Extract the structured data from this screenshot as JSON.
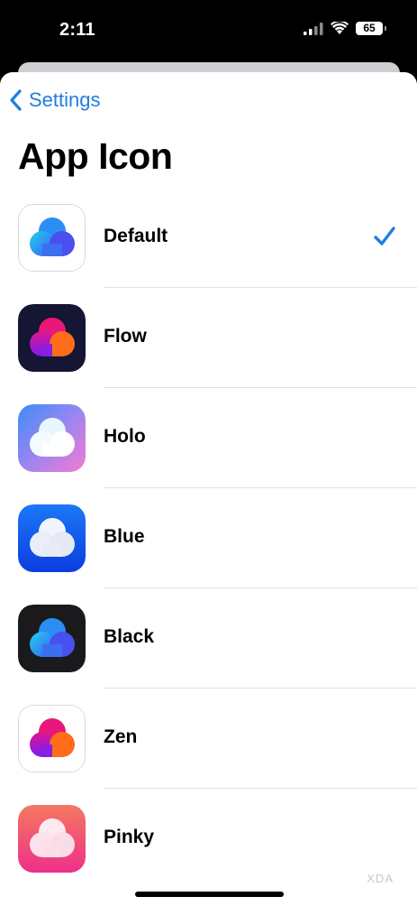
{
  "status_bar": {
    "time": "2:11",
    "battery": "65"
  },
  "nav": {
    "back_label": "Settings"
  },
  "title": "App Icon",
  "icons": [
    {
      "label": "Default",
      "selected": true
    },
    {
      "label": "Flow"
    },
    {
      "label": "Holo"
    },
    {
      "label": "Blue"
    },
    {
      "label": "Black"
    },
    {
      "label": "Zen"
    },
    {
      "label": "Pinky"
    }
  ],
  "watermark": "XDA",
  "colors": {
    "accent": "#1f7ee0",
    "divider": "#e2e2e4"
  }
}
